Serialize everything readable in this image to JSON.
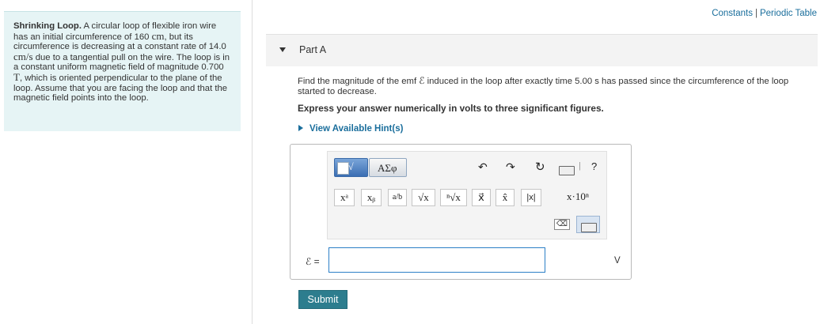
{
  "header": {
    "links": [
      "Constants",
      "Periodic Table"
    ],
    "separator": "|"
  },
  "problem": {
    "title": "Shrinking Loop.",
    "text_1": "A circular loop of flexible iron wire has an initial circumference of 160",
    "unit_cm_1": "cm",
    "text_2": ", but its circumference is decreasing at a constant rate of 14.0",
    "unit_rate": "cm/s",
    "text_3": "due to a tangential pull on the wire. The loop is in a constant uniform magnetic field of magnitude 0.700",
    "unit_T": "T",
    "text_4": ", which is oriented perpendicular to the plane of the loop. Assume that you are facing the loop and that the magnetic field points into the loop."
  },
  "part": {
    "title": "Part A",
    "question_1": "Find the magnitude of the emf",
    "emf_symbol": "ℰ",
    "question_2": "induced in the loop after exactly time 5.00 s has passed since the circumference of the loop started to decrease.",
    "instruction": "Express your answer numerically in volts to three significant figures.",
    "hints_link": "View Available Hint(s)"
  },
  "toolbar": {
    "templates_label": "√",
    "greek_label": "ΑΣφ",
    "undo_icon": "undo-icon",
    "redo_icon": "redo-icon",
    "reset_icon": "reset-icon",
    "keyboard_icon": "keyboard-icon",
    "help_label": "?",
    "symbols": [
      "xᵃ",
      "xᵦ",
      "a/b",
      "√x",
      "ⁿ√x",
      "x⃗",
      "x̂",
      "|x|",
      "x·10ⁿ"
    ],
    "backspace_icon": "backspace-icon",
    "keyboard_toggle_icon": "keyboard-toggle-icon"
  },
  "answer": {
    "label": "ℰ =",
    "value": "",
    "unit": "V"
  },
  "submit_label": "Submit"
}
